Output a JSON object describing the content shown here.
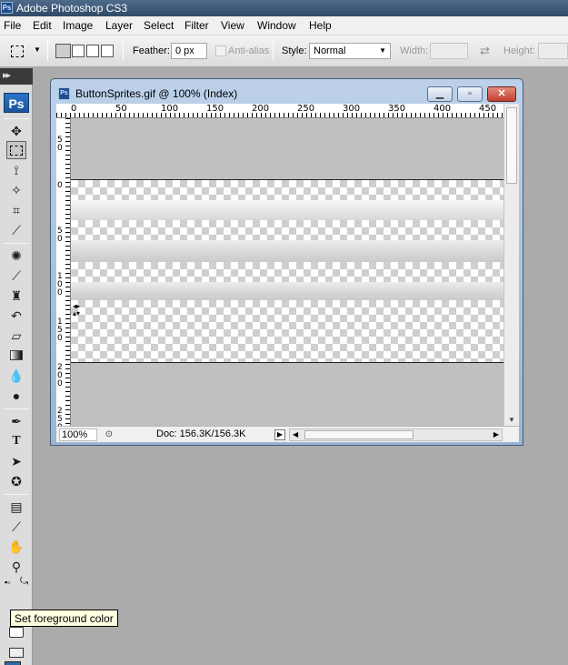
{
  "app": {
    "title": "Adobe Photoshop CS3",
    "ps_badge": "Ps"
  },
  "menu": [
    "File",
    "Edit",
    "Image",
    "Layer",
    "Select",
    "Filter",
    "View",
    "Window",
    "Help"
  ],
  "options": {
    "feather_label": "Feather:",
    "feather_value": "0 px",
    "antialias_label": "Anti-alias",
    "style_label": "Style:",
    "style_value": "Normal",
    "width_label": "Width:",
    "height_label": "Height:"
  },
  "document": {
    "title": "ButtonSprites.gif @ 100% (Index)",
    "zoom": "100%",
    "doc_info": "Doc: 156.3K/156.3K"
  },
  "ruler": {
    "top_ticks": [
      "0",
      "50",
      "100",
      "150",
      "200",
      "250",
      "300",
      "350",
      "400",
      "450"
    ],
    "left_ticks": [
      [
        "5",
        "0"
      ],
      [
        "0"
      ],
      [
        "5",
        "0"
      ],
      [
        "1",
        "0",
        "0"
      ],
      [
        "1",
        "5",
        "0"
      ],
      [
        "2",
        "0",
        "0"
      ],
      [
        "2",
        "5",
        "0"
      ]
    ]
  },
  "tooltip": {
    "text": "Set foreground color"
  },
  "colors": {
    "foreground": "#2f6aa6",
    "background": "#ffffff",
    "accent": "#1b5597"
  },
  "tools": [
    "move-tool",
    "marquee-tool",
    "lasso-tool",
    "magic-wand-tool",
    "crop-tool",
    "slice-tool",
    "healing-brush-tool",
    "brush-tool",
    "clone-stamp-tool",
    "history-brush-tool",
    "eraser-tool",
    "gradient-tool",
    "blur-tool",
    "dodge-tool",
    "pen-tool",
    "type-tool",
    "path-selection-tool",
    "custom-shape-tool",
    "notes-tool",
    "eyedropper-tool",
    "hand-tool",
    "zoom-tool"
  ]
}
